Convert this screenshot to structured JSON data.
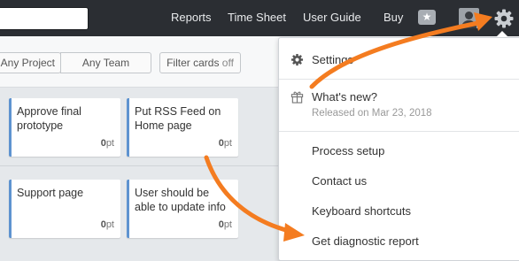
{
  "topbar": {
    "nav": [
      "Reports",
      "Time Sheet",
      "User Guide",
      "Buy"
    ],
    "star_glyph": "★"
  },
  "filters": {
    "project_label": "Any Project",
    "team_label": "Any Team",
    "cards_label": "Filter cards",
    "cards_state": "off"
  },
  "cards": [
    {
      "title": "Approve final prototype",
      "points": "0",
      "unit": "pt"
    },
    {
      "title": "Put RSS Feed on Home page",
      "points": "0",
      "unit": "pt"
    },
    {
      "title": "Support page",
      "points": "0",
      "unit": "pt"
    },
    {
      "title": "User should be able to update info",
      "points": "0",
      "unit": "pt"
    }
  ],
  "menu": {
    "settings": "Settings",
    "whats_new": "What's new?",
    "released": "Released on Mar 23, 2018",
    "process_setup": "Process setup",
    "contact_us": "Contact us",
    "shortcuts": "Keyboard shortcuts",
    "diagnostic": "Get diagnostic report"
  },
  "colors": {
    "topbar": "#2b2e33",
    "card_accent": "#5e93d0",
    "annotation_arrow": "#f47c20"
  },
  "icons": [
    "star-icon",
    "avatar-icon",
    "gear-icon",
    "settings-gear-icon",
    "gift-icon"
  ]
}
